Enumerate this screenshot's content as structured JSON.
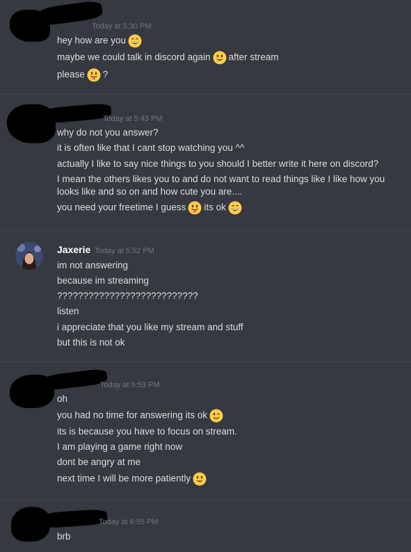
{
  "messages": [
    {
      "timestamp": "Today at 5:30 PM",
      "lines": [
        {
          "before": "hey how are you",
          "emoji": "grinning-face-icon",
          "after": ""
        },
        {
          "before": "maybe we could talk in discord again",
          "emoji": "smiley-face-icon",
          "after": "after stream"
        },
        {
          "before": "please",
          "emoji": "tongue-face-icon",
          "after": "?"
        }
      ]
    },
    {
      "timestamp": "Today at 5:43 PM",
      "lines": [
        {
          "text": "why do not you answer?"
        },
        {
          "text": "it is often like that I cant stop watching you ^^"
        },
        {
          "text": "actually I like to say nice things to you should I better write it here on discord?"
        },
        {
          "text": "I mean the others likes you to and do not want to read things like I like how you looks like and so on and how cute you are...."
        },
        {
          "before": "you need your freetime I guess",
          "emoji": "tongue-face-icon",
          "mid": "its ok",
          "emoji2": "grinning-face-icon"
        }
      ]
    },
    {
      "username": "Jaxerie",
      "timestamp": "Today at 5:52 PM",
      "lines": [
        {
          "text": "im not answering"
        },
        {
          "text": "because im streaming"
        },
        {
          "text": "???????????????????????????"
        },
        {
          "text": "listen"
        },
        {
          "text": "i appreciate that you like my stream and stuff"
        },
        {
          "text": "but this is not ok"
        }
      ]
    },
    {
      "timestamp": "Today at 5:53 PM",
      "lines": [
        {
          "text": "oh"
        },
        {
          "before": "you had no time for answering its ok",
          "emoji": "winking-face-icon"
        },
        {
          "text": "its is because you have to focus on stream."
        },
        {
          "text": "I am playing a game right now"
        },
        {
          "text": "dont be angry at me"
        },
        {
          "before": "next time I will be  more patiently",
          "emoji": "smiley-face-icon"
        }
      ]
    },
    {
      "timestamp": "Today at 6:55 PM",
      "lines": [
        {
          "text": "brb"
        }
      ]
    }
  ]
}
